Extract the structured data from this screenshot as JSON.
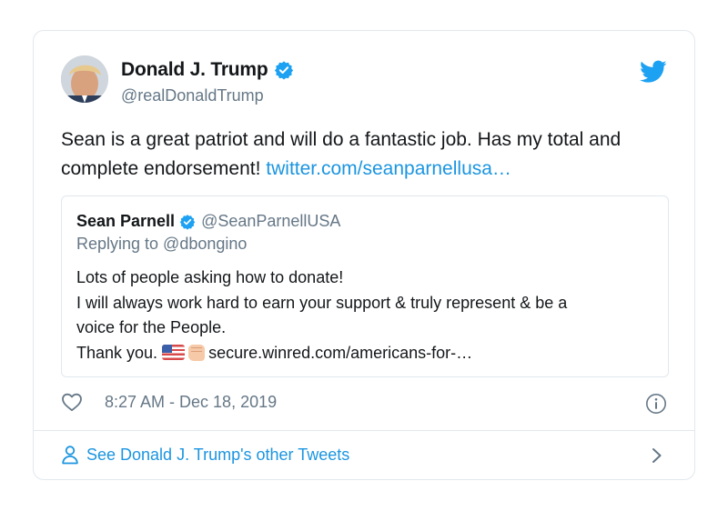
{
  "tweet": {
    "author_name": "Donald J. Trump",
    "author_handle": "@realDonaldTrump",
    "text": "Sean is a great patriot and will do a fantastic job. Has my total and complete endorsement! ",
    "link": "twitter.com/seanparnellusa…",
    "timestamp": "8:27 AM - Dec 18, 2019"
  },
  "quote": {
    "author_name": "Sean Parnell",
    "author_handle": "@SeanParnellUSA",
    "replying_to": "Replying to @dbongino",
    "line1": "Lots of people asking how to donate!",
    "line2": "I will always work hard to earn your support & truly represent & be a",
    "line3": "voice for the People.",
    "line4_text": "Thank you. ",
    "line4_link": "secure.winred.com/americans-for-…"
  },
  "footer": {
    "see_more": "See Donald J. Trump's other Tweets"
  },
  "icons": {
    "verified": "verified-badge-icon",
    "bird": "twitter-bird-icon",
    "heart": "heart-icon",
    "info": "info-icon",
    "person": "person-icon",
    "chevron": "chevron-right-icon"
  },
  "colors": {
    "accent": "#1b95e0",
    "text": "#14171a",
    "muted": "#657786",
    "border": "#e1e8ed"
  }
}
